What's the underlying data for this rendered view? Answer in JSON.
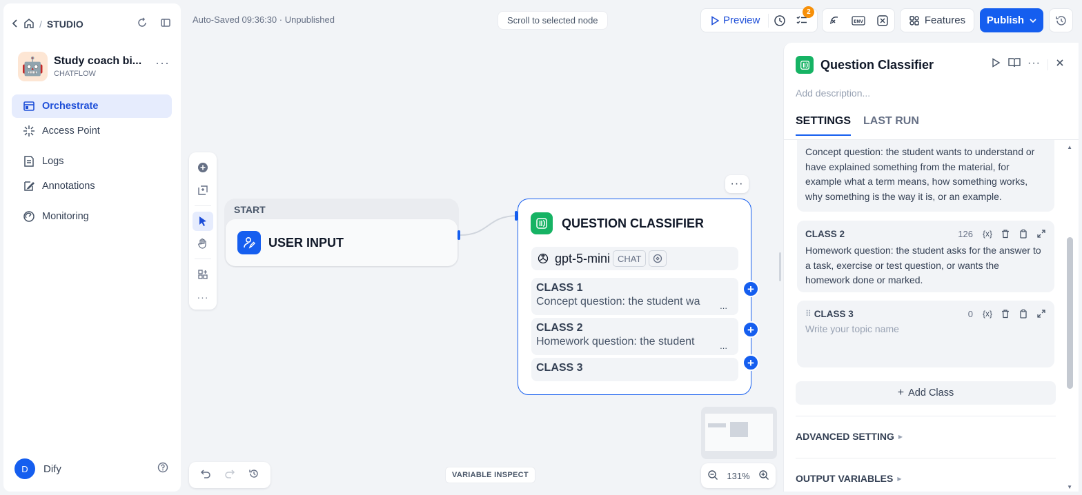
{
  "breadcrumb": {
    "studio": "STUDIO"
  },
  "app": {
    "name": "Study coach bi...",
    "type": "CHATFLOW",
    "avatar_emoji": "🤖"
  },
  "nav": [
    {
      "label": "Orchestrate",
      "active": true
    },
    {
      "label": "Access Point"
    },
    {
      "label": "Logs"
    },
    {
      "label": "Annotations"
    },
    {
      "label": "Monitoring"
    }
  ],
  "user": {
    "initial": "D",
    "name": "Dify"
  },
  "topbar": {
    "autosave": "Auto-Saved 09:36:30 · Unpublished",
    "scroll_to_selected": "Scroll to selected node",
    "preview": "Preview",
    "checklist_badge": "2",
    "features": "Features",
    "publish": "Publish"
  },
  "start_node": {
    "header": "START",
    "title": "USER INPUT"
  },
  "classifier_node": {
    "title": "QUESTION CLASSIFIER",
    "model": "gpt-5-mini",
    "model_tag": "CHAT",
    "classes": [
      {
        "name": "CLASS 1",
        "desc": "Concept question: the student wa"
      },
      {
        "name": "CLASS 2",
        "desc": "Homework question: the student"
      },
      {
        "name": "CLASS 3",
        "desc": ""
      }
    ],
    "ellipsis": "..."
  },
  "canvas": {
    "variable_inspect": "VARIABLE INSPECT",
    "zoom": "131%"
  },
  "panel": {
    "title": "Question Classifier",
    "description_placeholder": "Add description...",
    "tabs": [
      "SETTINGS",
      "LAST RUN"
    ],
    "class1_desc": "Concept question: the student wants to understand or have explained something from the material, for example what a term means, how something works, why something is the way it is, or an example.",
    "class2": {
      "name": "CLASS 2",
      "count": "126",
      "desc": "Homework question: the student asks for the answer to a task, exercise or test question, or wants the homework done or marked."
    },
    "class3": {
      "name": "CLASS 3",
      "count": "0",
      "placeholder": "Write your topic name"
    },
    "var_icon": "{x}",
    "add_class": "Add Class",
    "advanced": "ADVANCED SETTING",
    "output_vars": "OUTPUT VARIABLES"
  },
  "colors": {
    "accent": "#155eef",
    "classifier_green": "#16b364",
    "badge_orange": "#f79009"
  }
}
